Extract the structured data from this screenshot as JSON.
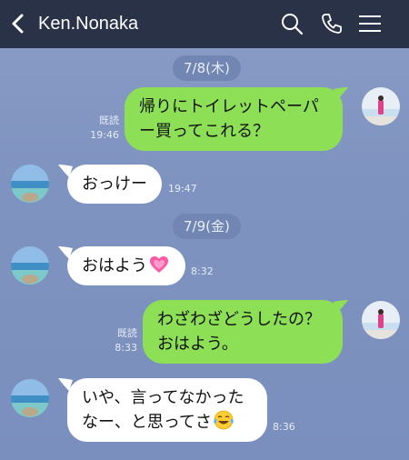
{
  "header": {
    "title": "Ken.Nonaka",
    "icons": [
      "back-icon",
      "search-icon",
      "phone-icon",
      "menu-icon"
    ],
    "background": "#2a3248"
  },
  "dates": [
    "7/8(木)",
    "7/9(金)"
  ],
  "messages": [
    {
      "side": "me",
      "lines": [
        "帰りにトイレットペーパ",
        "ー買ってこれる？"
      ],
      "read": "既読",
      "time": "19:46"
    },
    {
      "side": "them",
      "lines": [
        "おっけー"
      ],
      "time": "19:47"
    },
    {
      "side": "them",
      "lines": [
        "おはよう"
      ],
      "emoji": "growing-heart",
      "time": "8:32"
    },
    {
      "side": "me",
      "lines": [
        "わざわざどうしたの？",
        "おはよう。"
      ],
      "read": "既読",
      "time": "8:33"
    },
    {
      "side": "them",
      "lines": [
        "いや、言ってなかった",
        "なー、と思ってさ"
      ],
      "emoji": "tears-of-joy",
      "time": "8:36"
    }
  ],
  "colors": {
    "my_bubble": "#8de055",
    "their_bubble": "#ffffff",
    "chat_bg": "#8194c0"
  }
}
